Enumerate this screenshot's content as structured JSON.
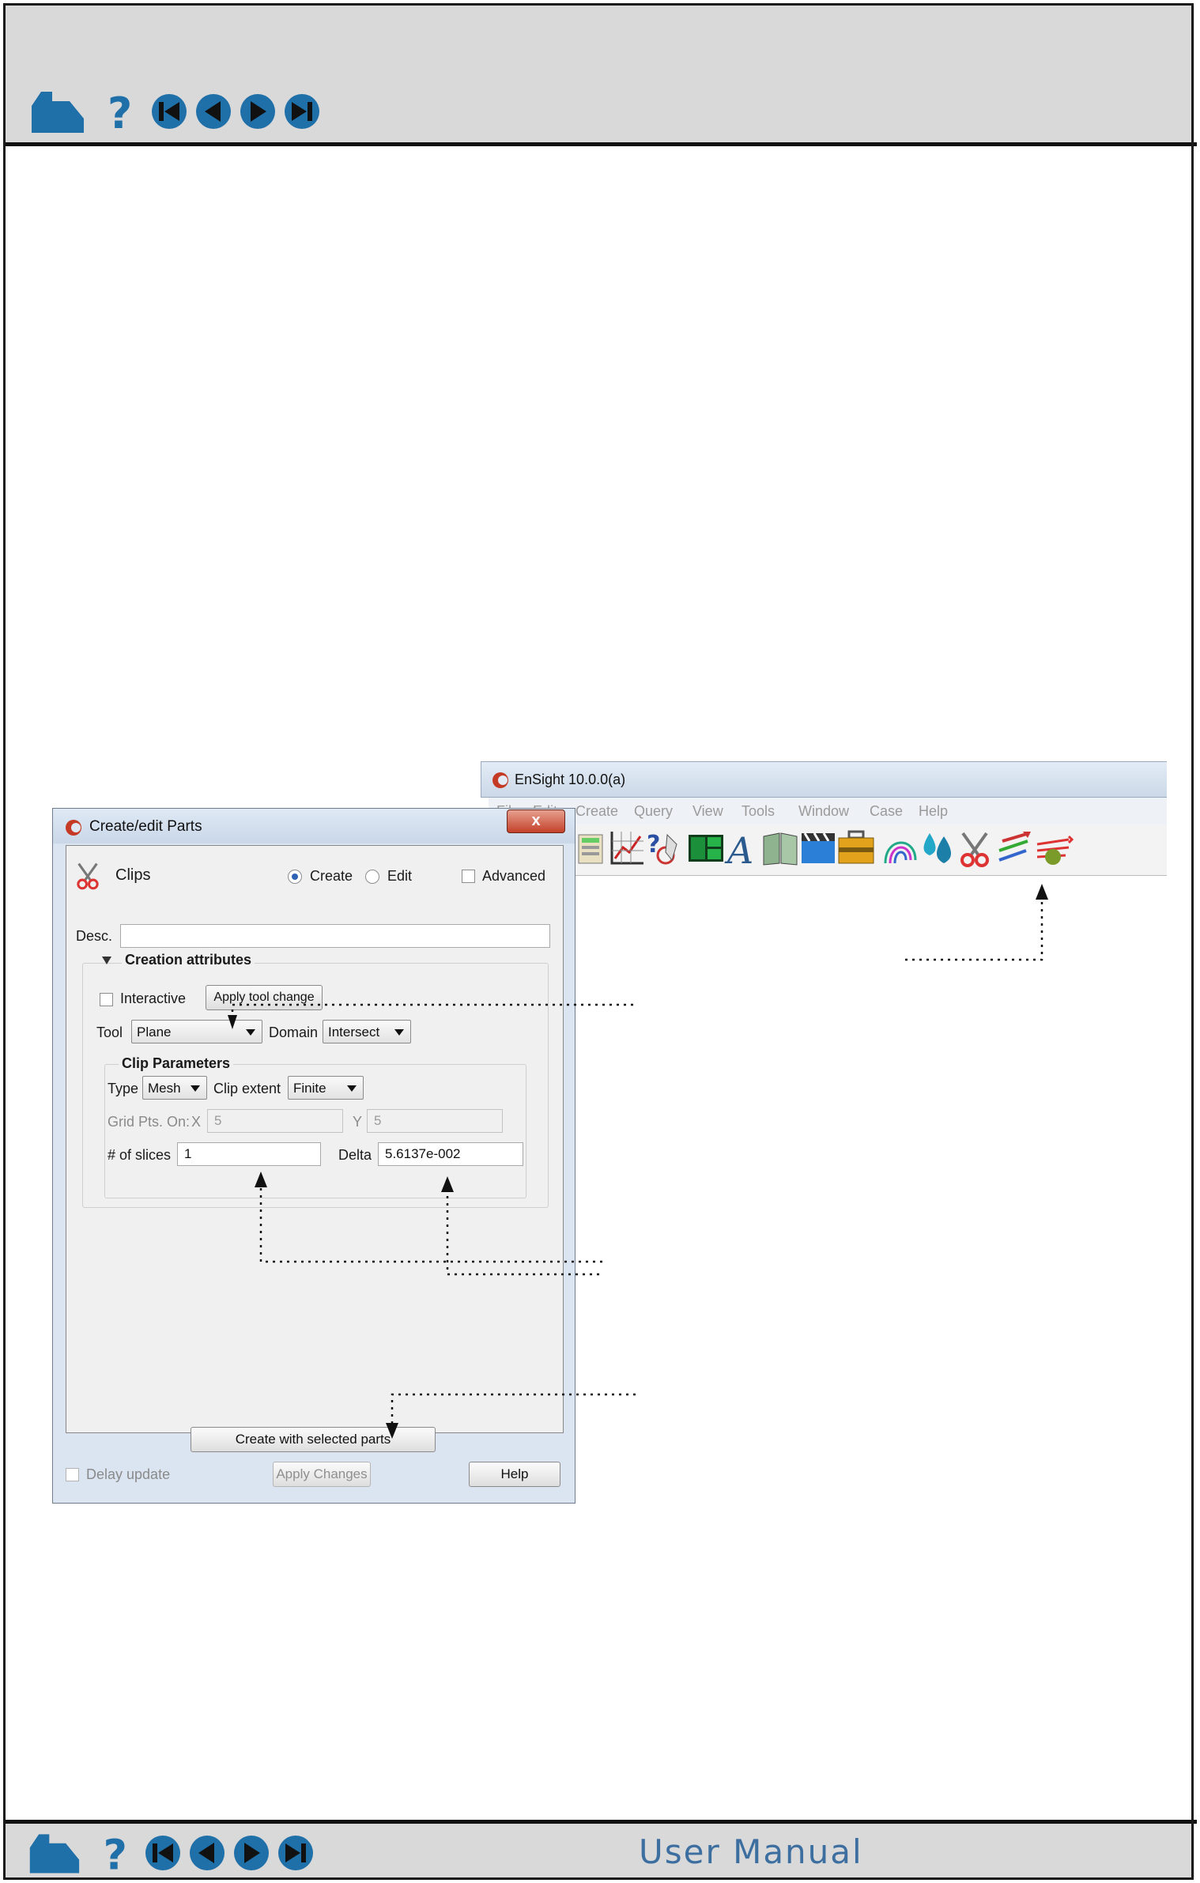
{
  "nav": {
    "icons": [
      "home-icon",
      "help-icon",
      "first-page-icon",
      "previous-page-icon",
      "next-page-icon",
      "last-page-icon"
    ],
    "footer_label": "User Manual",
    "accent": "#1f6fa8"
  },
  "ensight_window": {
    "title": "EnSight 10.0.0(a)",
    "menus": [
      "File",
      "Edit",
      "Create",
      "Query",
      "View",
      "Tools",
      "Window",
      "Case",
      "Help"
    ],
    "toolbar_icons": [
      "calculator-icon",
      "plotter-icon",
      "query-icon",
      "viewports-icon",
      "annotation-text-icon",
      "user-manual-icon",
      "movie-icon",
      "toolbox-icon",
      "contour-icon",
      "isosurface-icon",
      "clip-icon",
      "vector-arrows-icon",
      "particle-trace-icon"
    ]
  },
  "dialog": {
    "title": "Create/edit Parts",
    "close": "x",
    "part_type": "Clips",
    "mode_create": "Create",
    "mode_edit": "Edit",
    "advanced": "Advanced",
    "desc_label": "Desc.",
    "desc_value": "",
    "creation_section": "Creation attributes",
    "interactive": "Interactive",
    "apply_tool_change": "Apply tool change",
    "tool_label": "Tool",
    "tool_value": "Plane",
    "domain_label": "Domain",
    "domain_value": "Intersect",
    "clip_params": "Clip Parameters",
    "type_label": "Type",
    "type_value": "Mesh",
    "extent_label": "Clip extent",
    "extent_value": "Finite",
    "grid_label": "Grid Pts. On:",
    "grid_x_label": "X",
    "grid_x_value": "5",
    "grid_y_label": "Y",
    "grid_y_value": "5",
    "slices_label": "# of slices",
    "slices_value": "1",
    "delta_label": "Delta",
    "delta_value": "5.6137e-002",
    "create_btn": "Create with selected parts",
    "delay_update": "Delay update",
    "apply_changes": "Apply Changes",
    "help": "Help"
  }
}
